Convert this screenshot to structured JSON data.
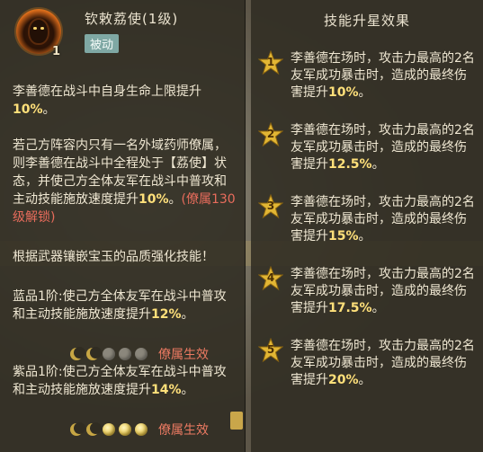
{
  "skill": {
    "name": "钦敕荔使(1级)",
    "level_badge": "1",
    "type": "被动"
  },
  "left_desc": {
    "p1_text": "李善德在战斗中自身生命上限提升",
    "p1_value": "10%",
    "p1_end": "。",
    "p2_text": "若己方阵容内只有一名外域药师僚属，则李善德在战斗中全程处于【荔使】状态，并使己方全体友军在战斗中普攻和主动技能施放速度提升",
    "p2_value": "10%",
    "p2_end": "。",
    "p2_unlock": "(僚属130级解锁)",
    "p3_text": "根据武器镶嵌宝玉的品质强化技能！",
    "blue_text": "蓝品1阶:使己方全体友军在战斗中普攻和主动技能施放速度提升",
    "blue_value": "12%",
    "blue_end": "。",
    "blue_status": "僚属生效",
    "purple_text": "紫品1阶:使己方全体友军在战斗中普攻和主动技能施放速度提升",
    "purple_value": "14%",
    "purple_end": "。",
    "purple_status": "僚属生效"
  },
  "right_panel": {
    "title": "技能升星效果",
    "stars": [
      {
        "num": "1",
        "text": "李善德在场时，攻击力最高的2名友军成功暴击时，造成的最终伤害提升",
        "value": "10%",
        "end": "。"
      },
      {
        "num": "2",
        "text": "李善德在场时，攻击力最高的2名友军成功暴击时，造成的最终伤害提升",
        "value": "12.5%",
        "end": "。"
      },
      {
        "num": "3",
        "text": "李善德在场时，攻击力最高的2名友军成功暴击时，造成的最终伤害提升",
        "value": "15%",
        "end": "。"
      },
      {
        "num": "4",
        "text": "李善德在场时，攻击力最高的2名友军成功暴击时，造成的最终伤害提升",
        "value": "17.5%",
        "end": "。"
      },
      {
        "num": "5",
        "text": "李善德在场时，攻击力最高的2名友军成功暴击时，造成的最终伤害提升",
        "value": "20%",
        "end": "。"
      }
    ]
  },
  "colors": {
    "highlight": "#ffe07a",
    "unlock": "#e86c5c",
    "passive_badge": "#7fa8a4",
    "star": "#e2b634"
  },
  "icons": {
    "avatar": "flame-portrait-icon",
    "star": "star-icon",
    "gem": "moon-gem-icon"
  }
}
